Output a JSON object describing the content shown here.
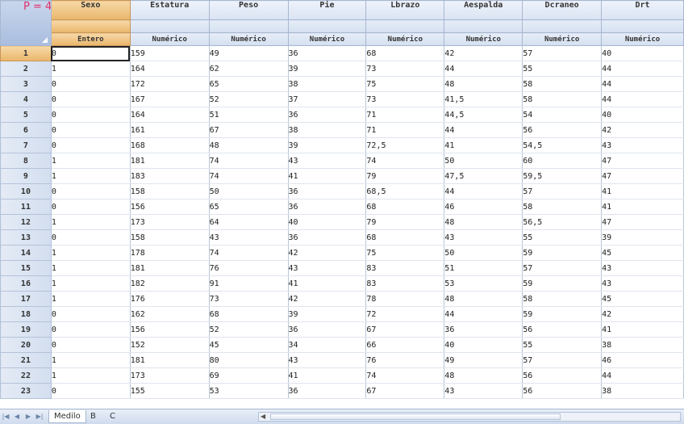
{
  "columns": [
    {
      "name": "Sexo",
      "type": "Entero"
    },
    {
      "name": "Estatura",
      "type": "Numérico"
    },
    {
      "name": "Peso",
      "type": "Numérico"
    },
    {
      "name": "Pie",
      "type": "Numérico"
    },
    {
      "name": "Lbrazo",
      "type": "Numérico"
    },
    {
      "name": "Aespalda",
      "type": "Numérico"
    },
    {
      "name": "Dcraneo",
      "type": "Numérico"
    },
    {
      "name": "Drt",
      "type": "Numérico"
    }
  ],
  "corner_mark": "P = 4",
  "row_numbers": [
    "1",
    "2",
    "3",
    "4",
    "5",
    "6",
    "7",
    "8",
    "9",
    "10",
    "11",
    "12",
    "13",
    "14",
    "15",
    "16",
    "17",
    "18",
    "19",
    "20",
    "21",
    "22",
    "23"
  ],
  "rows": [
    [
      "0",
      "159",
      "49",
      "36",
      "68",
      "42",
      "57",
      "40"
    ],
    [
      "1",
      "164",
      "62",
      "39",
      "73",
      "44",
      "55",
      "44"
    ],
    [
      "0",
      "172",
      "65",
      "38",
      "75",
      "48",
      "58",
      "44"
    ],
    [
      "0",
      "167",
      "52",
      "37",
      "73",
      "41,5",
      "58",
      "44"
    ],
    [
      "0",
      "164",
      "51",
      "36",
      "71",
      "44,5",
      "54",
      "40"
    ],
    [
      "0",
      "161",
      "67",
      "38",
      "71",
      "44",
      "56",
      "42"
    ],
    [
      "0",
      "168",
      "48",
      "39",
      "72,5",
      "41",
      "54,5",
      "43"
    ],
    [
      "1",
      "181",
      "74",
      "43",
      "74",
      "50",
      "60",
      "47"
    ],
    [
      "1",
      "183",
      "74",
      "41",
      "79",
      "47,5",
      "59,5",
      "47"
    ],
    [
      "0",
      "158",
      "50",
      "36",
      "68,5",
      "44",
      "57",
      "41"
    ],
    [
      "0",
      "156",
      "65",
      "36",
      "68",
      "46",
      "58",
      "41"
    ],
    [
      "1",
      "173",
      "64",
      "40",
      "79",
      "48",
      "56,5",
      "47"
    ],
    [
      "0",
      "158",
      "43",
      "36",
      "68",
      "43",
      "55",
      "39"
    ],
    [
      "1",
      "178",
      "74",
      "42",
      "75",
      "50",
      "59",
      "45"
    ],
    [
      "1",
      "181",
      "76",
      "43",
      "83",
      "51",
      "57",
      "43"
    ],
    [
      "1",
      "182",
      "91",
      "41",
      "83",
      "53",
      "59",
      "43"
    ],
    [
      "1",
      "176",
      "73",
      "42",
      "78",
      "48",
      "58",
      "45"
    ],
    [
      "0",
      "162",
      "68",
      "39",
      "72",
      "44",
      "59",
      "42"
    ],
    [
      "0",
      "156",
      "52",
      "36",
      "67",
      "36",
      "56",
      "41"
    ],
    [
      "0",
      "152",
      "45",
      "34",
      "66",
      "40",
      "55",
      "38"
    ],
    [
      "1",
      "181",
      "80",
      "43",
      "76",
      "49",
      "57",
      "46"
    ],
    [
      "1",
      "173",
      "69",
      "41",
      "74",
      "48",
      "56",
      "44"
    ],
    [
      "0",
      "155",
      "53",
      "36",
      "67",
      "43",
      "56",
      "38"
    ]
  ],
  "tabs": [
    "Medilo",
    "B",
    "C"
  ],
  "active_tab": "Medilo",
  "colors": {
    "selection": "#e9b66b",
    "header": "#d9e3f2",
    "corner_mark": "#e0306b"
  }
}
